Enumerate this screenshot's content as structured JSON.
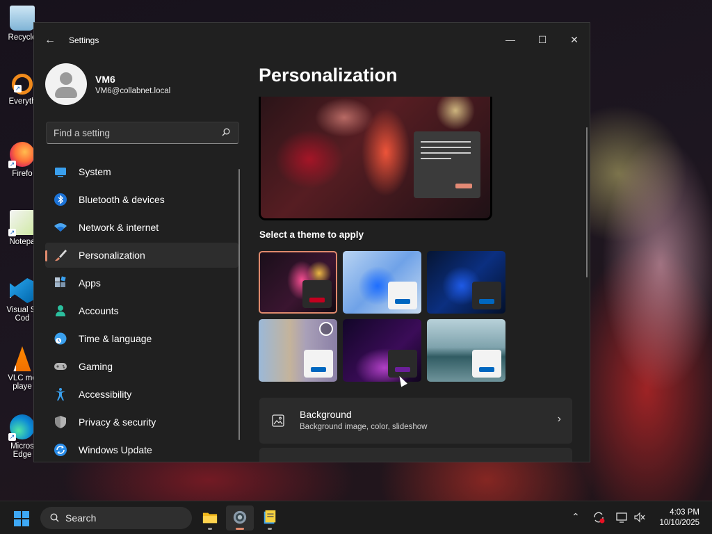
{
  "desktop": {
    "icons": [
      {
        "label": "Recycle",
        "icon": "recycle-bin-icon"
      },
      {
        "label": "Everyth",
        "icon": "everything-search-icon"
      },
      {
        "label": "Firefo",
        "icon": "firefox-icon"
      },
      {
        "label": "Notepa",
        "icon": "notepad-plus-plus-icon"
      },
      {
        "label": "Visual St Cod",
        "icon": "vscode-icon"
      },
      {
        "label": "VLC me playe",
        "icon": "vlc-icon"
      },
      {
        "label": "Micros Edge",
        "icon": "edge-icon"
      }
    ]
  },
  "window": {
    "title": "Settings",
    "back_glyph": "←",
    "min_glyph": "—",
    "max_glyph": "☐",
    "close_glyph": "✕"
  },
  "profile": {
    "name": "VM6",
    "email": "VM6@collabnet.local"
  },
  "search": {
    "placeholder": "Find a setting"
  },
  "nav": {
    "items": [
      {
        "label": "System",
        "icon": "system-monitor-icon"
      },
      {
        "label": "Bluetooth & devices",
        "icon": "bluetooth-icon"
      },
      {
        "label": "Network & internet",
        "icon": "wifi-icon"
      },
      {
        "label": "Personalization",
        "icon": "paintbrush-icon",
        "active": true
      },
      {
        "label": "Apps",
        "icon": "apps-icon"
      },
      {
        "label": "Accounts",
        "icon": "accounts-icon"
      },
      {
        "label": "Time & language",
        "icon": "time-language-icon"
      },
      {
        "label": "Gaming",
        "icon": "gamepad-icon"
      },
      {
        "label": "Accessibility",
        "icon": "accessibility-icon"
      },
      {
        "label": "Privacy & security",
        "icon": "shield-icon"
      },
      {
        "label": "Windows Update",
        "icon": "windows-update-icon"
      }
    ]
  },
  "main": {
    "title": "Personalization",
    "theme_heading": "Select a theme to apply",
    "themes": [
      {
        "id": "glow",
        "selected": true,
        "accent": "#c4001f"
      },
      {
        "id": "windows-light",
        "accent": "#0067c0"
      },
      {
        "id": "windows-dark",
        "accent": "#0067c0"
      },
      {
        "id": "captured-motion",
        "accent": "#0067c0"
      },
      {
        "id": "flow",
        "accent": "#6b1f9a"
      },
      {
        "id": "sunrise",
        "accent": "#0067c0"
      }
    ],
    "background_card": {
      "title": "Background",
      "subtitle": "Background image, color, slideshow",
      "chevron": "›"
    }
  },
  "taskbar": {
    "search_label": "Search",
    "apps": [
      "file-explorer-icon",
      "settings-icon",
      "notepad-icon"
    ],
    "tray": [
      "chevron-up-icon",
      "sync-alert-icon",
      "display-icon",
      "mute-icon"
    ],
    "time": "4:03 PM",
    "date": "10/10/2025"
  },
  "colors": {
    "accent": "#e08a6d",
    "window_bg": "#202020",
    "card_bg": "#2b2b2b"
  }
}
